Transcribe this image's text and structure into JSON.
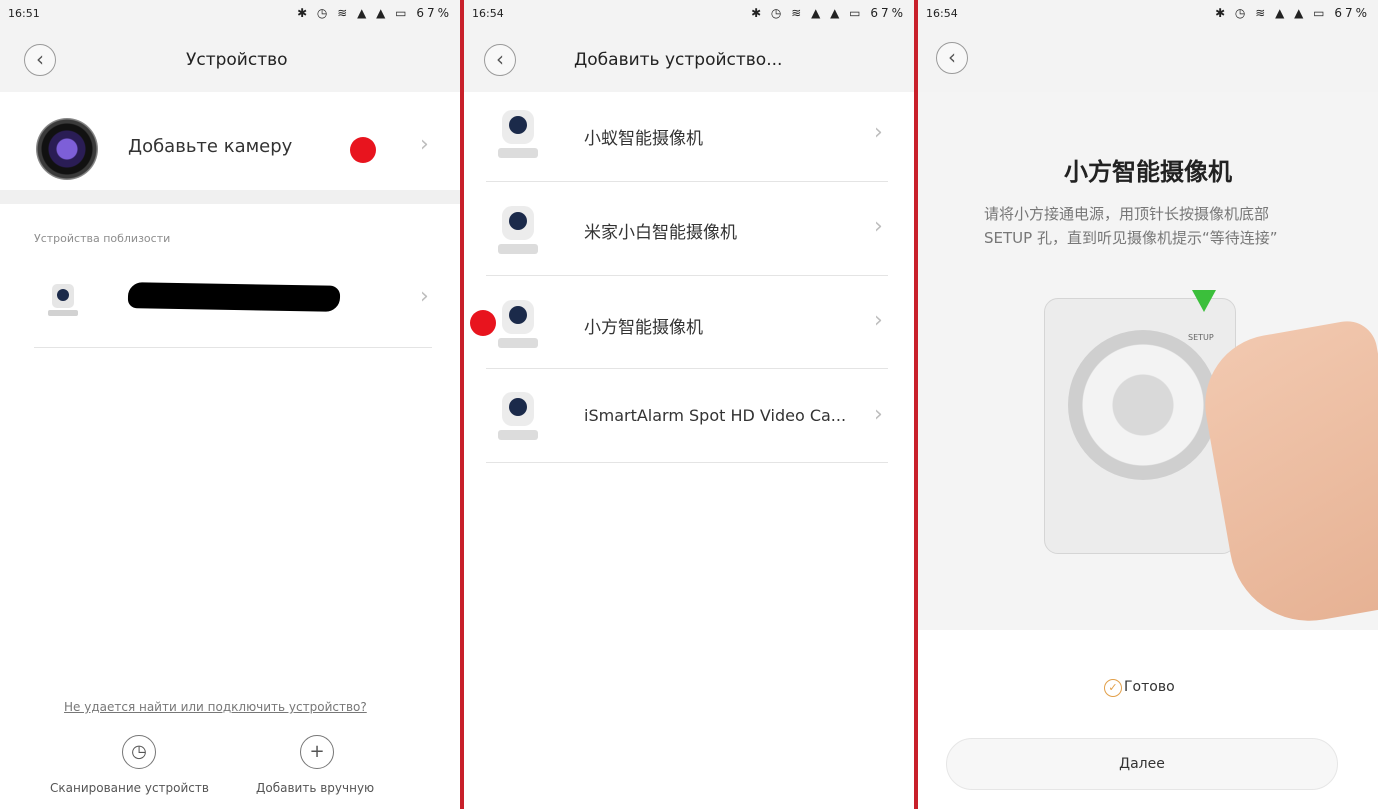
{
  "screens": [
    {
      "status": {
        "time": "16:51",
        "battery": "67%"
      },
      "title": "Устройство",
      "add_camera": {
        "label": "Добавьте камеру"
      },
      "nearby_section_label": "Устройства поблизости",
      "help_link": "Не удается найти или подключить устройство?",
      "actions": [
        {
          "label": "Сканирование устройств",
          "icon": "scan-icon"
        },
        {
          "label": "Добавить вручную",
          "icon": "plus-icon"
        }
      ]
    },
    {
      "status": {
        "time": "16:54",
        "battery": "67%"
      },
      "title": "Добавить устройство...",
      "devices": [
        {
          "name": "小蚁智能摄像机"
        },
        {
          "name": "米家小白智能摄像机"
        },
        {
          "name": "小方智能摄像机"
        },
        {
          "name": "iSmartAlarm Spot HD Video Ca..."
        }
      ]
    },
    {
      "status": {
        "time": "16:54",
        "battery": "67%"
      },
      "camera_title": "小方智能摄像机",
      "instruction": "请将小方接通电源，用顶针长按摄像机底部 SETUP 孔，直到听见摄像机提示“等待连接”",
      "setup_label": "SETUP",
      "ready_label": "Готово",
      "next_button": "Далее"
    }
  ],
  "colors": {
    "highlight": "#e8141e",
    "divider": "#c8202a",
    "check": "#e2a04a",
    "arrow": "#3bbf3b"
  }
}
